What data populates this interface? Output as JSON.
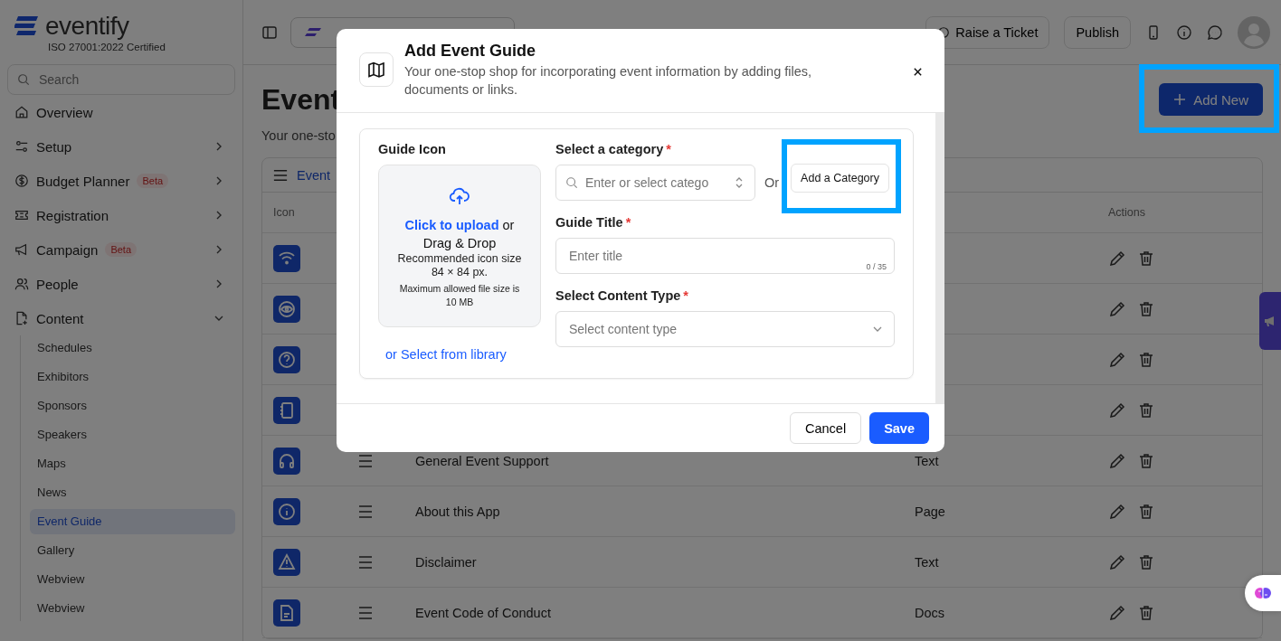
{
  "sidebar": {
    "brand": "eventify",
    "certification": "ISO 27001:2022 Certified",
    "search": {
      "placeholder": "Search"
    },
    "items": [
      {
        "label": "Overview",
        "kind": "home"
      },
      {
        "label": "Setup",
        "kind": "sliders",
        "expanded": false
      },
      {
        "label": "Budget Planner",
        "kind": "dollar",
        "badge": "Beta",
        "expanded": false
      },
      {
        "label": "Registration",
        "kind": "ticket",
        "expanded": false
      },
      {
        "label": "Campaign",
        "kind": "megaphone",
        "badge": "Beta",
        "expanded": false
      },
      {
        "label": "People",
        "kind": "people",
        "expanded": false
      },
      {
        "label": "Content",
        "kind": "file",
        "expanded": true,
        "children": [
          {
            "label": "Schedules",
            "selected": false
          },
          {
            "label": "Exhibitors",
            "selected": false
          },
          {
            "label": "Sponsors",
            "selected": false
          },
          {
            "label": "Speakers",
            "selected": false
          },
          {
            "label": "Maps",
            "selected": false
          },
          {
            "label": "News",
            "selected": false
          },
          {
            "label": "Event Guide",
            "selected": true
          },
          {
            "label": "Gallery",
            "selected": false
          },
          {
            "label": "Webview",
            "selected": false
          },
          {
            "label": "Webview",
            "selected": false
          }
        ]
      }
    ]
  },
  "topbar": {
    "buttons": [
      "Raise a Ticket",
      "Publish"
    ]
  },
  "page": {
    "title": "Event",
    "subtitle": "Your one-sto",
    "add_button": "Add New",
    "tab": "Event",
    "table": {
      "columns": [
        "Icon",
        "Actions"
      ],
      "rows": [
        {
          "kind": "wifi"
        },
        {
          "kind": "eye"
        },
        {
          "kind": "question"
        },
        {
          "kind": "notebook"
        },
        {
          "kind": "headphones",
          "title": "General Event Support",
          "type": "Text"
        },
        {
          "kind": "info",
          "title": "About this App",
          "type": "Page"
        },
        {
          "kind": "warning",
          "title": "Disclaimer",
          "type": "Text"
        },
        {
          "kind": "document",
          "title": "Event Code of Conduct",
          "type": "Docs"
        }
      ]
    }
  },
  "modal": {
    "title": "Add Event Guide",
    "subtitle": "Your one-stop shop for incorporating event information by adding files, documents or links.",
    "guide_icon": {
      "label": "Guide Icon",
      "upload_link": "Click to upload",
      "upload_text": "or Drag & Drop",
      "size_hint": "Recommended icon size 84 × 84 px.",
      "file_hint": "Maximum allowed file size is 10 MB",
      "library_link": "or Select from library"
    },
    "category": {
      "label": "Select a category",
      "required_mark": "*",
      "placeholder": "Enter or select catego",
      "or": "Or",
      "add_button": "Add a Category"
    },
    "title_field": {
      "label": "Guide Title",
      "required_mark": "*",
      "placeholder": "Enter title",
      "counter": "0 / 35"
    },
    "content_type": {
      "label": "Select Content Type",
      "required_mark": "*",
      "placeholder": "Select content type"
    },
    "buttons": {
      "cancel": "Cancel",
      "save": "Save"
    }
  }
}
